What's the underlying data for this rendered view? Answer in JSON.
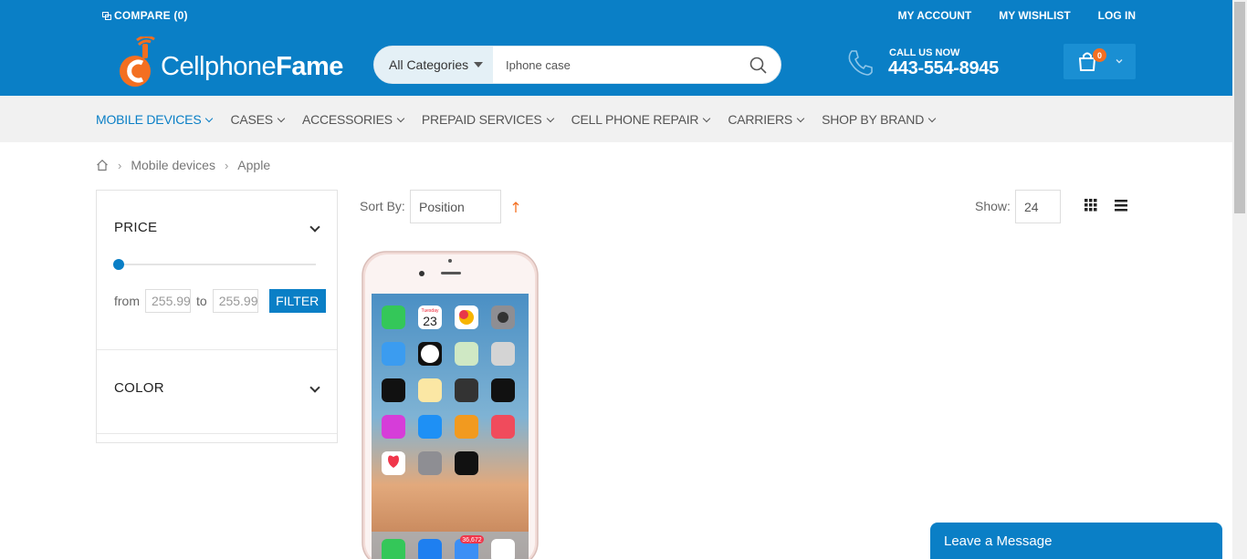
{
  "topbar": {
    "compare": "COMPARE (0)",
    "links": [
      "MY ACCOUNT",
      "MY WISHLIST",
      "LOG IN"
    ]
  },
  "header": {
    "logo_text_light": "Cellphone",
    "logo_text_bold": "Fame",
    "search": {
      "category": "All Categories",
      "query": "Iphone case"
    },
    "call": {
      "label": "CALL US NOW",
      "number": "443-554-8945"
    },
    "cart_count": "0"
  },
  "nav": {
    "items": [
      "MOBILE DEVICES",
      "CASES",
      "ACCESSORIES",
      "PREPAID SERVICES",
      "CELL PHONE REPAIR",
      "CARRIERS",
      "SHOP BY BRAND"
    ]
  },
  "breadcrumb": [
    "Mobile devices",
    "Apple"
  ],
  "filters": {
    "price": {
      "title": "PRICE",
      "from_label": "from",
      "to_label": "to",
      "from_value": "255.99",
      "to_value": "255.99",
      "button": "FILTER"
    },
    "color": {
      "title": "COLOR"
    }
  },
  "toolbar": {
    "sort_label": "Sort By:",
    "sort_value": "Position",
    "show_label": "Show:",
    "show_value": "24"
  },
  "product": {
    "screen_date_day": "Tuesday",
    "screen_date_num": "23",
    "mail_badge": "36,672"
  },
  "chat": {
    "label": "Leave a Message"
  },
  "colors": {
    "primary": "#0a7fc6",
    "accent": "#f36f21",
    "nav_bg": "#f1f1f1"
  }
}
